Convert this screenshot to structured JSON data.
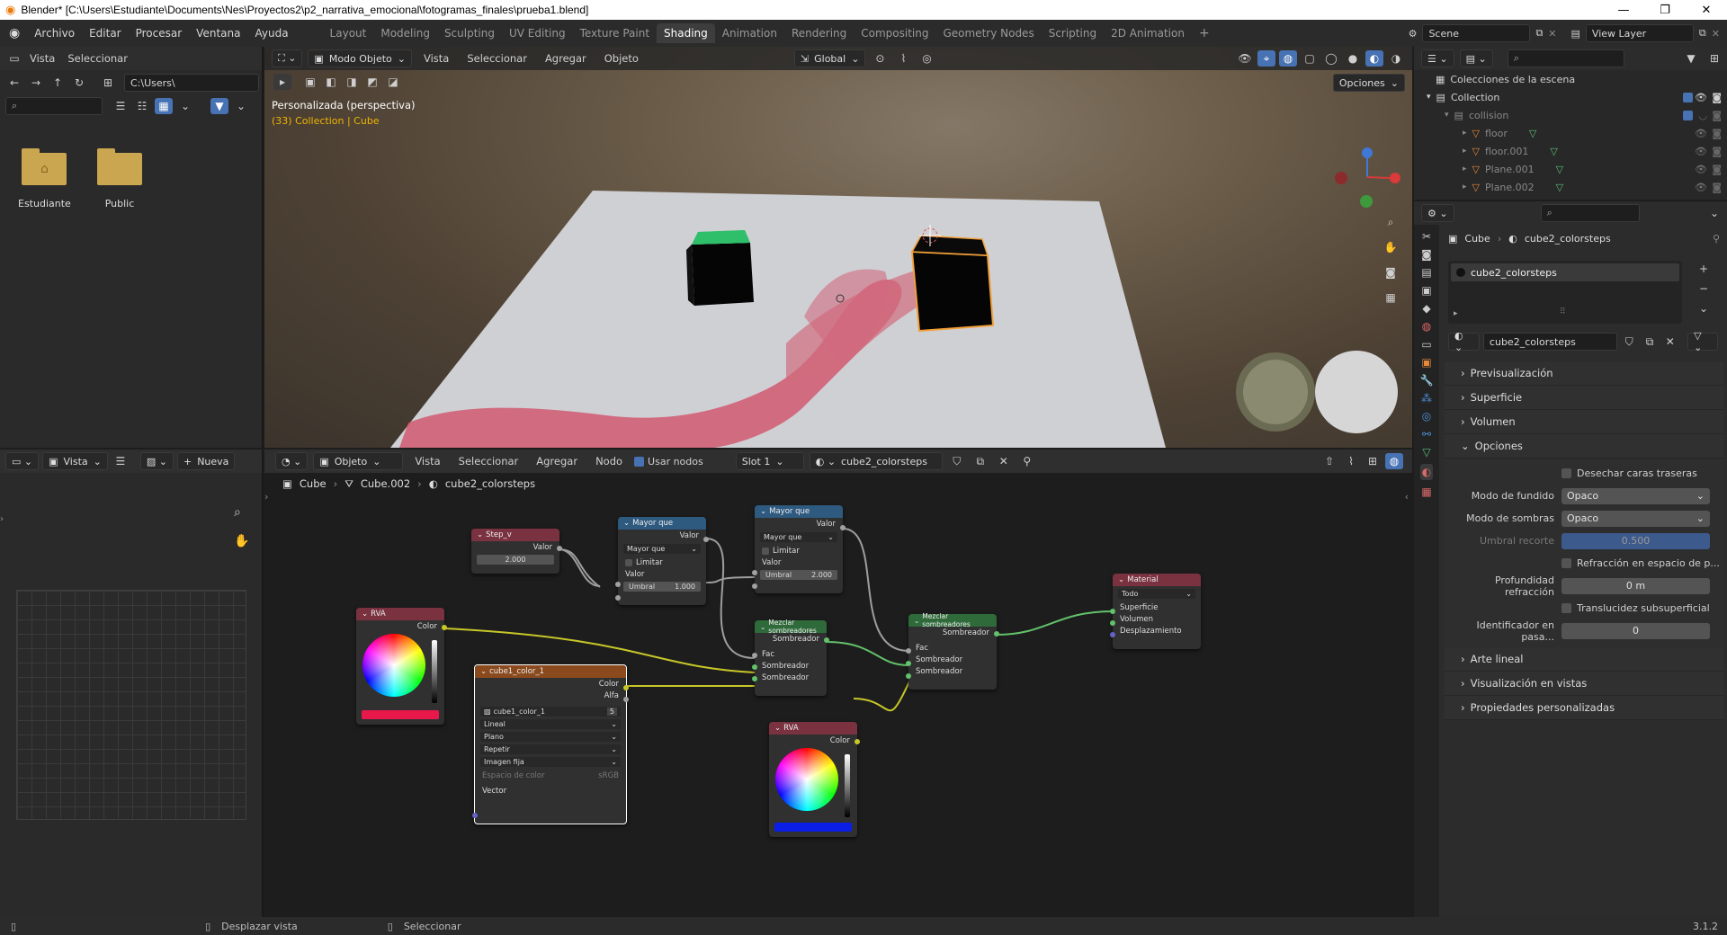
{
  "window": {
    "title": "Blender* [C:\\Users\\Estudiante\\Documents\\Nes\\Proyectos2\\p2_narrativa_emocional\\fotogramas_finales\\prueba1.blend]",
    "controls": [
      "—",
      "❐",
      "✕"
    ]
  },
  "menubar": {
    "menus": [
      "Archivo",
      "Editar",
      "Procesar",
      "Ventana",
      "Ayuda"
    ],
    "workspaces": [
      "Layout",
      "Modeling",
      "Sculpting",
      "UV Editing",
      "Texture Paint",
      "Shading",
      "Animation",
      "Rendering",
      "Compositing",
      "Geometry Nodes",
      "Scripting",
      "2D Animation"
    ],
    "active_workspace": "Shading",
    "scene": "Scene",
    "view_layer": "View Layer"
  },
  "filebrowser": {
    "header": [
      "Vista",
      "Seleccionar"
    ],
    "path": "C:\\Users\\",
    "folders": [
      "Estudiante",
      "Public"
    ]
  },
  "viewport": {
    "mode": "Modo Objeto",
    "menus": [
      "Vista",
      "Seleccionar",
      "Agregar",
      "Objeto"
    ],
    "orientation": "Global",
    "options_label": "Opciones",
    "overlay_title": "Personalizada (perspectiva)",
    "overlay_sub": "(33) Collection | Cube",
    "colors": {
      "plane": "#cfd0d4",
      "green_face": "#2fbf6a",
      "selected_outline": "#f2a03a",
      "paint": "#d24a63"
    }
  },
  "node_editor": {
    "header": {
      "view": "Vista",
      "new_label": "Nueva",
      "object_dd": "Objeto",
      "menus": [
        "Vista",
        "Seleccionar",
        "Agregar",
        "Nodo"
      ],
      "use_nodes": "Usar nodos",
      "slot": "Slot 1",
      "material": "cube2_colorsteps"
    },
    "breadcrumb": [
      "Cube",
      "Cube.002",
      "cube2_colorsteps"
    ],
    "nodes": {
      "step": {
        "title": "Step_v",
        "out": "Valor",
        "value": "2.000"
      },
      "mayor1": {
        "title": "Mayor que",
        "out": "Valor",
        "op": "Mayor que",
        "clamp": "Limitar",
        "in": "Valor",
        "thr_label": "Umbral",
        "thr": "1.000"
      },
      "mayor2": {
        "title": "Mayor que",
        "out": "Valor",
        "op": "Mayor que",
        "clamp": "Limitar",
        "in": "Valor",
        "thr_label": "Umbral",
        "thr": "2.000"
      },
      "rva1": {
        "title": "RVA",
        "out": "Color",
        "swatch": "#e8194a"
      },
      "rva2": {
        "title": "RVA",
        "out": "Color",
        "swatch": "#0a1ee6"
      },
      "tex": {
        "title": "cube1_color_1",
        "out1": "Color",
        "out2": "Alfa",
        "img": "cube1_color_1",
        "users": "5",
        "interp": "Lineal",
        "proj": "Plano",
        "ext": "Repetir",
        "src": "Imagen fija",
        "cs_label": "Espacio de color",
        "cs": "sRGB",
        "in": "Vector"
      },
      "mix1": {
        "title": "Mezclar sombreadores",
        "out": "Sombreador",
        "fac": "Fac",
        "s1": "Sombreador",
        "s2": "Sombreador"
      },
      "mix2": {
        "title": "Mezclar sombreadores",
        "out": "Sombreador",
        "fac": "Fac",
        "s1": "Sombreador",
        "s2": "Sombreador"
      },
      "material": {
        "title": "Material",
        "target": "Todo",
        "in1": "Superficie",
        "in2": "Volumen",
        "in3": "Desplazamiento"
      }
    }
  },
  "outliner": {
    "root": "Colecciones de la escena",
    "items": [
      {
        "label": "Collection",
        "level": 0
      },
      {
        "label": "collision",
        "level": 1
      },
      {
        "label": "floor",
        "level": 2
      },
      {
        "label": "floor.001",
        "level": 2
      },
      {
        "label": "Plane.001",
        "level": 2
      },
      {
        "label": "Plane.002",
        "level": 2
      }
    ]
  },
  "properties": {
    "breadcrumb_obj": "Cube",
    "breadcrumb_mat": "cube2_colorsteps",
    "slot": "cube2_colorsteps",
    "material": "cube2_colorsteps",
    "sections": [
      "Previsualización",
      "Superficie",
      "Volumen",
      "Opciones"
    ],
    "options": {
      "backface": "Desechar caras traseras",
      "blend_label": "Modo de fundido",
      "blend": "Opaco",
      "shadow_label": "Modo de sombras",
      "shadow": "Opaco",
      "clip_label": "Umbral recorte",
      "clip": "0.500",
      "refraction": "Refracción en espacio de p...",
      "depth_label": "Profundidad refracción",
      "depth": "0 m",
      "sss": "Translucidez subsuperficial",
      "pass_label": "Identificador en pasa...",
      "pass": "0"
    },
    "sections_after": [
      "Arte lineal",
      "Visualización en vistas",
      "Propiedades personalizadas"
    ]
  },
  "statusbar": {
    "pan": "Desplazar vista",
    "select": "Seleccionar",
    "version": "3.1.2"
  }
}
